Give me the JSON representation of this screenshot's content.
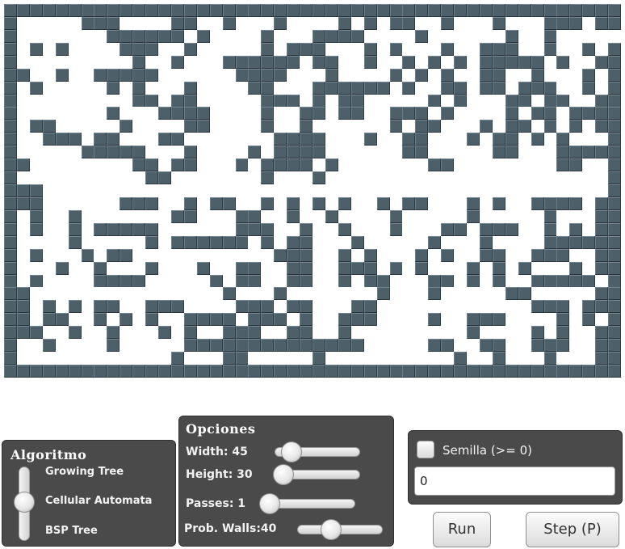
{
  "grid": {
    "cols": 48,
    "rows": 29,
    "map": [
      "111111111111111111111111111111111111111111111111",
      "100000111000011001000100001010110010001000111011",
      "100000001111110100001000111100001000000100100000",
      "101010000111001000001011100010100010011100100101",
      "100000000010010001111110110010010101011111010011",
      "110010011111000000111100010000101010011001000101",
      "101000001010001000011000111111010011011011100101",
      "100000000011011000001110101100000101000110110011",
      "100000001000111100001001101100111010000101101111",
      "101100000100001100001001000000101100010110101011",
      "100111011000110000000111100010011000101101010001",
      "100000111110001000010111100000011000001100011111",
      "110000000011011000101111010000000110000000011001",
      "100000000001100000001000100000000000000000000001",
      "111000000000000000000000000000000000000000000001",
      "111000000111001011001010101001011000101001111011",
      "101001000000011000110010010000100000100000100011",
      "101001011111000000111001001000100011011100101011",
      "100001000001011111101011000100000100010000111111",
      "101000101100000000000111001010001010011001110011",
      "100010010001000100110011001110101000101010001011",
      "101000011110000010110011001011000110101001111101",
      "110000000000000001000100000001000100000110000011",
      "110101011001110000111011000110000000000001110111",
      "110110010101001111011101001110000100111000010101",
      "111001001000101001110011001000000000100001010011",
      "100100001000001111111111111100000110011001110011",
      "100000000000010001100000100000000001001000100011",
      "111111111111111111111111111111111111111111111111"
    ]
  },
  "algoritmo": {
    "title": "Algoritmo",
    "options": [
      "Growing Tree",
      "Cellular Automata",
      "BSP Tree"
    ],
    "selected_index": 1
  },
  "opciones": {
    "title": "Opciones",
    "width_label": "Width: 45",
    "width_value": 45,
    "width_fraction": 0.2,
    "height_label": "Height: 30",
    "height_value": 30,
    "height_fraction": 0.1,
    "passes_label": "Passes: 1",
    "passes_value": 1,
    "passes_fraction": 0.0,
    "prob_label": "Prob. Walls:40",
    "prob_value": 40,
    "prob_fraction": 0.4
  },
  "semilla": {
    "label": "Semilla (>= 0)",
    "checked": false,
    "value": "0"
  },
  "buttons": {
    "run": "Run",
    "step": "Step (P)"
  },
  "colors": {
    "wall": "#4d5f69",
    "floor": "#ffffff",
    "panel": "#4a4a4a"
  }
}
